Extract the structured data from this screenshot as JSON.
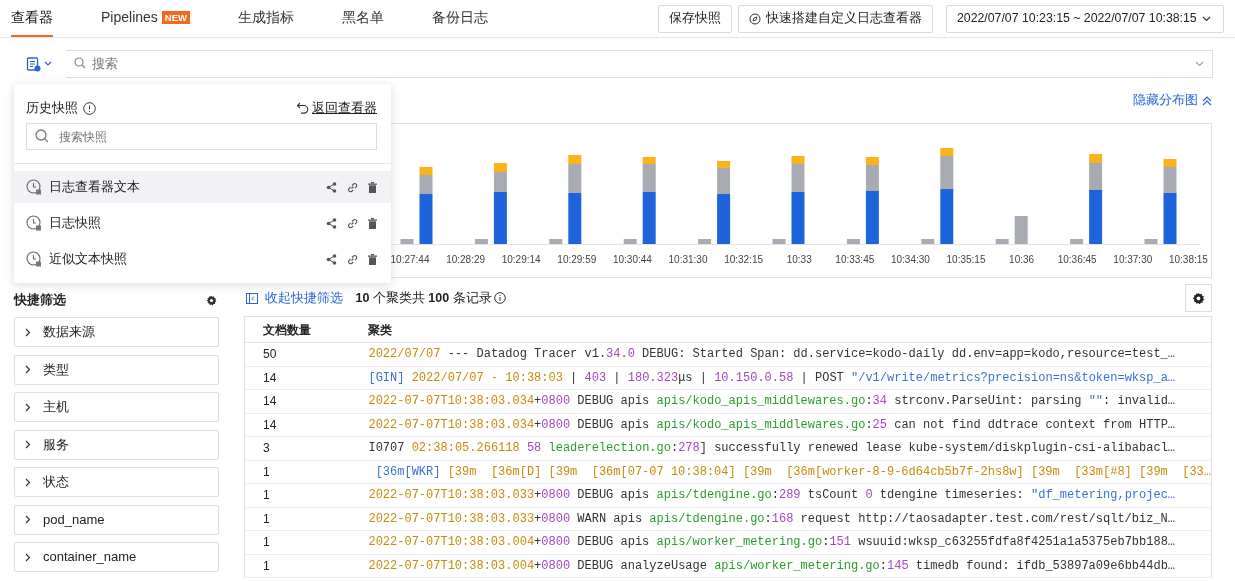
{
  "tabs": [
    {
      "label": "查看器",
      "selected": true
    },
    {
      "label": "Pipelines",
      "selected": false,
      "badge": "NEW"
    },
    {
      "label": "生成指标",
      "selected": false
    },
    {
      "label": "黑名单",
      "selected": false
    },
    {
      "label": "备份日志",
      "selected": false
    }
  ],
  "toolbar": {
    "buttons": [
      {
        "kind": "plain",
        "label": "保存快照"
      },
      {
        "kind": "compass",
        "label": "快速搭建自定义日志查看器"
      }
    ],
    "time_range": "2022/07/07 10:23:15 ~ 2022/07/07 10:38:15"
  },
  "search": {
    "placeholder": "搜索"
  },
  "snapshot_popup": {
    "title": "历史快照",
    "back_label": "返回查看器",
    "search_placeholder": "搜索快照",
    "items": [
      {
        "label": "日志查看器文本",
        "selected": true
      },
      {
        "label": "日志快照",
        "selected": false
      },
      {
        "label": "近似文本快照",
        "selected": false
      }
    ]
  },
  "chart": {
    "toggle_label": "隐藏分布图",
    "x_labels": [
      "10:27:44",
      "10:28:29",
      "10:29:14",
      "10:29:59",
      "10:30:44",
      "10:31:30",
      "10:32:15",
      "10:33",
      "10:33:45",
      "10:34:30",
      "10:35:15",
      "10:36",
      "10:36:45",
      "10:37:30",
      "10:38:15"
    ]
  },
  "quick_filter": {
    "title": "快捷筛选",
    "items": [
      "数据来源",
      "类型",
      "主机",
      "服务",
      "状态",
      "pod_name",
      "container_name"
    ]
  },
  "results": {
    "collapse_label": "收起快捷筛选",
    "summary": "**10** 个聚类共 **100** 条记录",
    "columns": [
      "文档数量",
      "聚类"
    ],
    "rows": [
      {
        "count": "50",
        "segments": [
          {
            "kind": "date",
            "text": "2022/07/07"
          },
          {
            "kind": "plain",
            "text": " --- Datadog Tracer v1."
          },
          {
            "kind": "number",
            "text": "34.0"
          },
          {
            "kind": "plain",
            "text": " DEBUG: Started Span: dd.service=kodo-daily dd.env=app=kodo,resource=test_…"
          }
        ]
      },
      {
        "count": "14",
        "segments": [
          {
            "kind": "string",
            "text": "[GIN]"
          },
          {
            "kind": "date",
            "text": " 2022/07/07 - 10:38:03"
          },
          {
            "kind": "plain",
            "text": " | "
          },
          {
            "kind": "number",
            "text": "403"
          },
          {
            "kind": "plain",
            "text": " | "
          },
          {
            "kind": "number",
            "text": "180.323"
          },
          {
            "kind": "plain",
            "text": "μs | "
          },
          {
            "kind": "number",
            "text": "10.150.0.58"
          },
          {
            "kind": "plain",
            "text": " | POST "
          },
          {
            "kind": "string",
            "text": "\"/v1/write/metrics?precision=ns&token=wksp_a…"
          }
        ]
      },
      {
        "count": "14",
        "segments": [
          {
            "kind": "date",
            "text": "2022-07-07T10:38:03.034"
          },
          {
            "kind": "plain",
            "text": "+"
          },
          {
            "kind": "number",
            "text": "0800"
          },
          {
            "kind": "plain",
            "text": " DEBUG apis "
          },
          {
            "kind": "path",
            "text": "apis/kodo_apis_middlewares.go"
          },
          {
            "kind": "plain",
            "text": ":"
          },
          {
            "kind": "number",
            "text": "34"
          },
          {
            "kind": "plain",
            "text": " strconv.ParseUint: parsing "
          },
          {
            "kind": "string",
            "text": "\"\""
          },
          {
            "kind": "plain",
            "text": ": invalid…"
          }
        ]
      },
      {
        "count": "14",
        "segments": [
          {
            "kind": "date",
            "text": "2022-07-07T10:38:03.034"
          },
          {
            "kind": "plain",
            "text": "+"
          },
          {
            "kind": "number",
            "text": "0800"
          },
          {
            "kind": "plain",
            "text": " DEBUG apis "
          },
          {
            "kind": "path",
            "text": "apis/kodo_apis_middlewares.go"
          },
          {
            "kind": "plain",
            "text": ":"
          },
          {
            "kind": "number",
            "text": "25"
          },
          {
            "kind": "plain",
            "text": " can not find ddtrace context from HTTP…"
          }
        ]
      },
      {
        "count": "3",
        "segments": [
          {
            "kind": "plain",
            "text": "I0707 "
          },
          {
            "kind": "date",
            "text": "02:38:05.266118"
          },
          {
            "kind": "number",
            "text": " 58"
          },
          {
            "kind": "path",
            "text": " leaderelection.go"
          },
          {
            "kind": "plain",
            "text": ":"
          },
          {
            "kind": "number",
            "text": "278"
          },
          {
            "kind": "plain",
            "text": "] successfully renewed lease kube-system/diskplugin-csi-alibabacl…"
          }
        ]
      },
      {
        "count": "1",
        "segments": [
          {
            "kind": "string",
            "text": " [36m[WKR]"
          },
          {
            "kind": "date",
            "text": " [39m  [36m[D] [39m  [36m[07-07 10:38:04] [39m  [36m[worker-8-9-6d64cb5b7f-2hs8w] [39m  [33m[#8] [39m  [33…"
          }
        ]
      },
      {
        "count": "1",
        "segments": [
          {
            "kind": "date",
            "text": "2022-07-07T10:38:03.033"
          },
          {
            "kind": "plain",
            "text": "+"
          },
          {
            "kind": "number",
            "text": "0800"
          },
          {
            "kind": "plain",
            "text": " DEBUG apis "
          },
          {
            "kind": "path",
            "text": "apis/tdengine.go"
          },
          {
            "kind": "plain",
            "text": ":"
          },
          {
            "kind": "number",
            "text": "289"
          },
          {
            "kind": "plain",
            "text": " tsCount "
          },
          {
            "kind": "number",
            "text": "0"
          },
          {
            "kind": "plain",
            "text": " tdengine timeseries: "
          },
          {
            "kind": "string",
            "text": "\"df_metering,projec…"
          }
        ]
      },
      {
        "count": "1",
        "segments": [
          {
            "kind": "date",
            "text": "2022-07-07T10:38:03.033"
          },
          {
            "kind": "plain",
            "text": "+"
          },
          {
            "kind": "number",
            "text": "0800"
          },
          {
            "kind": "plain",
            "text": " WARN apis "
          },
          {
            "kind": "path",
            "text": "apis/tdengine.go"
          },
          {
            "kind": "plain",
            "text": ":"
          },
          {
            "kind": "number",
            "text": "168"
          },
          {
            "kind": "plain",
            "text": " request http://taosadapter.test.com/rest/sqlt/biz_N…"
          }
        ]
      },
      {
        "count": "1",
        "segments": [
          {
            "kind": "date",
            "text": "2022-07-07T10:38:03.004"
          },
          {
            "kind": "plain",
            "text": "+"
          },
          {
            "kind": "number",
            "text": "0800"
          },
          {
            "kind": "plain",
            "text": " DEBUG apis "
          },
          {
            "kind": "path",
            "text": "apis/worker_metering.go"
          },
          {
            "kind": "plain",
            "text": ":"
          },
          {
            "kind": "number",
            "text": "151"
          },
          {
            "kind": "plain",
            "text": " wsuuid:wksp_c63255fdfa8f4251a1a5375eb7bb188…"
          }
        ]
      },
      {
        "count": "1",
        "segments": [
          {
            "kind": "date",
            "text": "2022-07-07T10:38:03.004"
          },
          {
            "kind": "plain",
            "text": "+"
          },
          {
            "kind": "number",
            "text": "0800"
          },
          {
            "kind": "plain",
            "text": " DEBUG analyzeUsage "
          },
          {
            "kind": "path",
            "text": "apis/worker_metering.go"
          },
          {
            "kind": "plain",
            "text": ":"
          },
          {
            "kind": "number",
            "text": "145"
          },
          {
            "kind": "plain",
            "text": " timedb found: ifdb_53897a09e6bb44db…"
          }
        ]
      }
    ]
  }
}
